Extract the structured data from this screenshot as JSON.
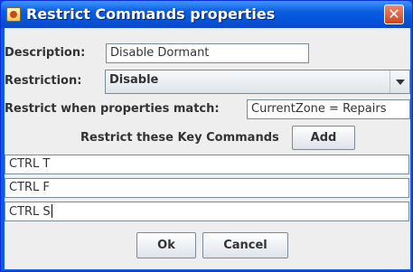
{
  "window": {
    "title": "Restrict Commands properties",
    "close_glyph": "✕"
  },
  "form": {
    "description_label": "Description:",
    "description_value": "Disable Dormant",
    "restriction_label": "Restriction:",
    "restriction_value": "Disable",
    "match_label": "Restrict when properties match:",
    "match_value": "CurrentZone = Repairs",
    "key_commands_label": "Restrict these Key Commands",
    "add_label": "Add",
    "key_commands": [
      "CTRL T",
      "CTRL F",
      "CTRL S"
    ]
  },
  "buttons": {
    "ok_label": "Ok",
    "cancel_label": "Cancel"
  },
  "icons": {
    "title_icon": "java-app-icon",
    "close_icon": "close-icon",
    "dropdown_icon": "chevron-down-icon"
  },
  "colors": {
    "title_bar": "#0a5ce0",
    "close_button": "#d1431e",
    "panel_background": "#eeeeee"
  }
}
